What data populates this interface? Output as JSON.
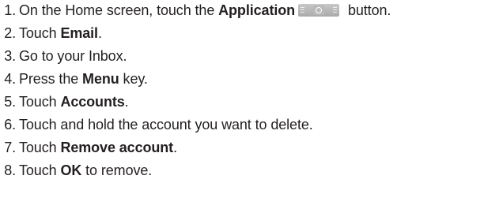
{
  "steps": [
    {
      "number": "1.",
      "pre": "On the Home screen, touch the ",
      "bold": "Application",
      "post": " button.",
      "icon": "application-launcher-icon"
    },
    {
      "number": "2.",
      "pre": "Touch ",
      "bold": "Email",
      "post": "."
    },
    {
      "number": "3.",
      "text": "Go to your Inbox."
    },
    {
      "number": "4.",
      "pre": "Press the ",
      "bold": "Menu",
      "post": " key."
    },
    {
      "number": "5.",
      "pre": "Touch ",
      "bold": "Accounts",
      "post": "."
    },
    {
      "number": "6.",
      "text": "Touch and hold the account you want to delete."
    },
    {
      "number": "7.",
      "pre": "Touch ",
      "bold": "Remove account",
      "post": "."
    },
    {
      "number": "8.",
      "pre": "Touch ",
      "bold": "OK",
      "post": " to remove."
    }
  ]
}
